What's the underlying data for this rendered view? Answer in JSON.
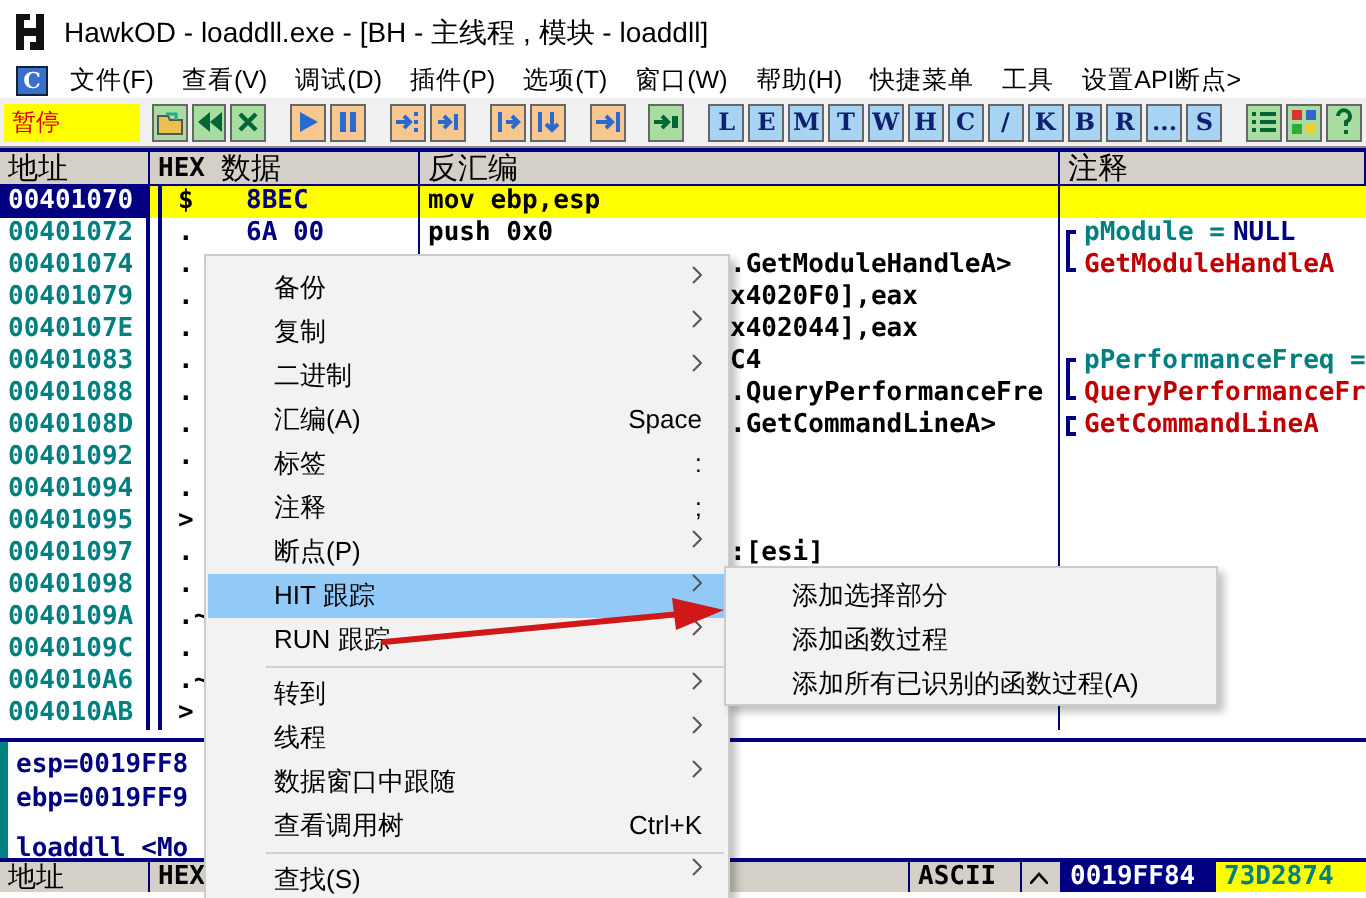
{
  "window": {
    "title": "HawkOD  - loaddll.exe - [BH - 主线程 , 模块 - loaddll]"
  },
  "menu_bar": {
    "app_button": "C",
    "items": [
      "文件(F)",
      "查看(V)",
      "调试(D)",
      "插件(P)",
      "选项(T)",
      "窗口(W)",
      "帮助(H)",
      "快捷菜单",
      "工具",
      "设置API断点>"
    ]
  },
  "toolbar": {
    "status": "暂停",
    "letter_buttons": [
      "L",
      "E",
      "M",
      "T",
      "W",
      "H",
      "C",
      "/",
      "K",
      "B",
      "R",
      "...",
      "S"
    ]
  },
  "disassembly": {
    "columns": [
      "地址",
      "HEX",
      "数据",
      "反汇编",
      "注释"
    ],
    "rows": [
      {
        "address": "00401070",
        "marker": "$",
        "hex": "8BEC",
        "disasm": "mov ebp,esp",
        "selected": true
      },
      {
        "address": "00401072",
        "marker": ".",
        "hex": "6A 00",
        "disasm": "push 0x0",
        "selected": false,
        "bracket_top": true,
        "bracket_bottom": false,
        "comment": [
          {
            "text": "pModule =",
            "color": "#008080"
          },
          {
            "text": "NULL",
            "color": "#000080"
          }
        ]
      },
      {
        "address": "00401074",
        "marker": ".",
        "disasm": ".GetModuleHandleA>",
        "selected": false,
        "bracket_top": false,
        "bracket_bottom": true,
        "comment": [
          {
            "text": "GetModuleHandleA",
            "color": "#c00000"
          }
        ]
      },
      {
        "address": "00401079",
        "marker": ".",
        "disasm": "x4020F0],eax",
        "selected": false
      },
      {
        "address": "0040107E",
        "marker": ".",
        "disasm": "x402044],eax",
        "selected": false
      },
      {
        "address": "00401083",
        "marker": ".",
        "disasm": "C4",
        "selected": false,
        "bracket_top": true,
        "bracket_bottom": false,
        "comment": [
          {
            "text": "pPerformanceFreq =",
            "color": "#008080"
          }
        ]
      },
      {
        "address": "00401088",
        "marker": ".",
        "disasm": ".QueryPerformanceFre",
        "selected": false,
        "bracket_top": false,
        "bracket_bottom": true,
        "comment": [
          {
            "text": "QueryPerformanceFr",
            "color": "#c00000"
          }
        ]
      },
      {
        "address": "0040108D",
        "marker": ".",
        "disasm": ".GetCommandLineA>",
        "selected": false,
        "bracket_top": true,
        "bracket_bottom": true,
        "comment": [
          {
            "text": "GetCommandLineA",
            "color": "#c00000"
          }
        ]
      },
      {
        "address": "00401092",
        "marker": ".",
        "selected": false
      },
      {
        "address": "00401094",
        "marker": ".",
        "selected": false
      },
      {
        "address": "00401095",
        "marker": ">",
        "selected": false
      },
      {
        "address": "00401097",
        "marker": ".",
        "disasm": ":[esi]",
        "selected": false
      },
      {
        "address": "00401098",
        "marker": ".",
        "selected": false
      },
      {
        "address": "0040109A",
        "marker": ".~",
        "selected": false
      },
      {
        "address": "0040109C",
        "marker": ".",
        "selected": false
      },
      {
        "address": "004010A6",
        "marker": ".~",
        "selected": false
      },
      {
        "address": "004010AB",
        "marker": ">",
        "selected": false
      }
    ]
  },
  "info_pane": {
    "lines": [
      "esp=0019FF8",
      "ebp=0019FF9"
    ],
    "module_line": "loaddll <Mo"
  },
  "dump_header": {
    "columns": [
      "地址",
      "HEX"
    ],
    "ascii": "ASCII",
    "stack_address": "0019FF84",
    "stack_value": "73D2874"
  },
  "context_menu": {
    "items": [
      {
        "kind": "item",
        "label": "备份",
        "submenu": true,
        "selected": false
      },
      {
        "kind": "item",
        "label": "复制",
        "submenu": true,
        "selected": false
      },
      {
        "kind": "item",
        "label": "二进制",
        "submenu": true,
        "selected": false
      },
      {
        "kind": "item",
        "label": "汇编(A)",
        "shortcut": "Space",
        "submenu": false,
        "selected": false
      },
      {
        "kind": "item",
        "label": "标签",
        "shortcut": ":",
        "submenu": false,
        "selected": false
      },
      {
        "kind": "item",
        "label": "注释",
        "shortcut": ";",
        "submenu": false,
        "selected": false
      },
      {
        "kind": "item",
        "label": "断点(P)",
        "submenu": true,
        "selected": false
      },
      {
        "kind": "item",
        "label": "HIT 跟踪",
        "submenu": true,
        "selected": true
      },
      {
        "kind": "item",
        "label": "RUN 跟踪",
        "submenu": true,
        "selected": false
      },
      {
        "kind": "separator"
      },
      {
        "kind": "item",
        "label": "转到",
        "submenu": true,
        "selected": false
      },
      {
        "kind": "item",
        "label": "线程",
        "submenu": true,
        "selected": false
      },
      {
        "kind": "item",
        "label": "数据窗口中跟随",
        "submenu": true,
        "selected": false
      },
      {
        "kind": "item",
        "label": "查看调用树",
        "shortcut": "Ctrl+K",
        "submenu": false,
        "selected": false
      },
      {
        "kind": "separator"
      },
      {
        "kind": "item",
        "label": "查找(S)",
        "submenu": true,
        "selected": false
      }
    ]
  },
  "submenu": {
    "items": [
      "添加选择部分",
      "添加函数过程",
      "添加所有已识别的函数过程(A)"
    ]
  }
}
